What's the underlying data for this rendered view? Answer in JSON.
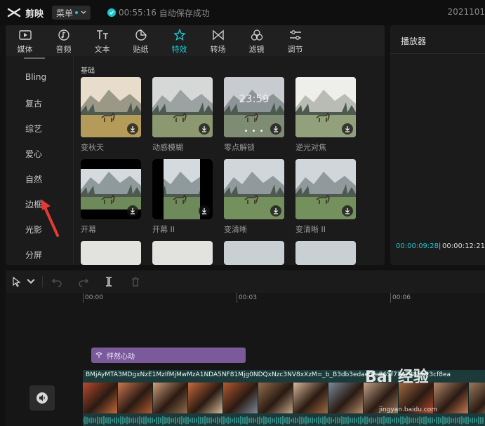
{
  "app": {
    "name": "剪映",
    "menu_label": "菜单",
    "save_time": "00:55:16",
    "save_status": "自动保存成功",
    "top_right_text": "2021101"
  },
  "toolbar": {
    "items": [
      {
        "label": "媒体",
        "icon": "media-icon"
      },
      {
        "label": "音频",
        "icon": "audio-icon"
      },
      {
        "label": "文本",
        "icon": "text-icon"
      },
      {
        "label": "贴纸",
        "icon": "sticker-icon"
      },
      {
        "label": "特效",
        "icon": "effects-icon",
        "active": true
      },
      {
        "label": "转场",
        "icon": "transition-icon"
      },
      {
        "label": "滤镜",
        "icon": "filter-icon"
      },
      {
        "label": "调节",
        "icon": "adjust-icon"
      }
    ]
  },
  "categories": [
    "Bling",
    "复古",
    "综艺",
    "爱心",
    "自然",
    "边框",
    "光影",
    "分屏"
  ],
  "effects": {
    "section_title": "基础",
    "items": [
      {
        "label": "变秋天"
      },
      {
        "label": "动感模糊"
      },
      {
        "label": "零点解锁",
        "clock": "23:59",
        "dots": "• • •"
      },
      {
        "label": "逆光对焦"
      },
      {
        "label": "开幕"
      },
      {
        "label": "开幕 II"
      },
      {
        "label": "变清晰"
      },
      {
        "label": "变清晰 II"
      }
    ]
  },
  "player": {
    "title": "播放器",
    "current_time": "00:00:09:28",
    "separator": "|",
    "total_time": "00:00:12:21"
  },
  "timeline": {
    "ruler": [
      "00:00",
      "00:03",
      "00:06"
    ],
    "audio_clip": "怦然心动",
    "video_clip_name": "BMjAyMTA3MDgxNzE1MzIfMjMwMzA1NDA5NF81Mjg0NDQxNzc3NV8xXzM=_b_B3db3edae5fe865f71e7385b23cf8ea",
    "watermark": "Bai 经验",
    "watermark_url": "jingyan.baidu.com"
  },
  "colors": {
    "accent": "#1ec6d0",
    "audio_clip": "#7a5a9a",
    "video_track": "#1d3a3a"
  }
}
